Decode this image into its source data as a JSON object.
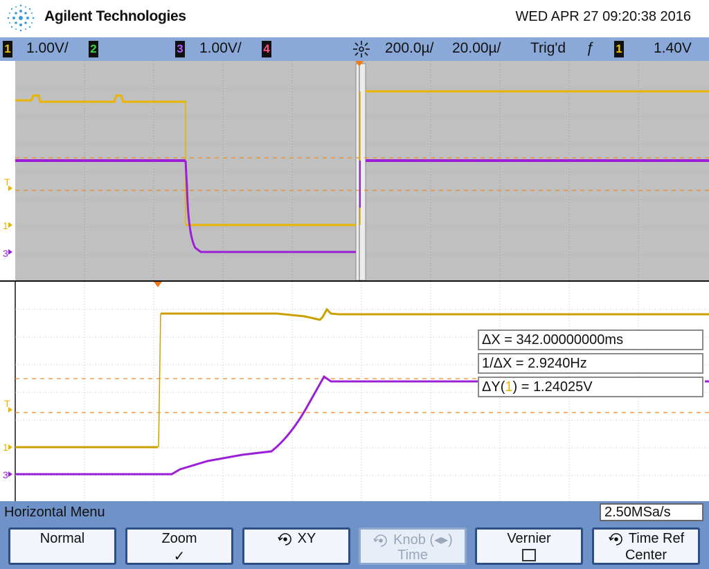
{
  "header": {
    "brand": "Agilent Technologies",
    "datetime": "WED APR 27 09:20:38 2016"
  },
  "channels": {
    "ch1_num": "1",
    "ch1_scale": "1.00V/",
    "ch2_num": "2",
    "ch3_num": "3",
    "ch3_scale": "1.00V/",
    "ch4_num": "4",
    "timebase": "200.0µ/",
    "zoom_timebase": "20.00µ/",
    "trigger_status": "Trig'd",
    "trigger_slope": "ƒ",
    "trigger_source": "1",
    "trigger_level": "1.40V"
  },
  "markers": {
    "trigger": "T",
    "ch1": "1",
    "ch3": "3"
  },
  "measurements": {
    "delta_x": "ΔX = 342.00000000ms",
    "inv_delta_x": "1/ΔX = 2.9240Hz",
    "delta_y_prefix": "ΔY(",
    "delta_y_channel": "1",
    "delta_y_suffix": ") = 1.24025V"
  },
  "menu": {
    "title": "Horizontal Menu",
    "sample_rate": "2.50MSa/s",
    "softkeys": {
      "normal": "Normal",
      "zoom": "Zoom",
      "zoom_check": "✓",
      "xy": "XY",
      "knob_time_line1": "Knob (◂▸)",
      "knob_time_line2": "Time",
      "vernier": "Vernier",
      "time_ref_line1": "Time Ref",
      "time_ref_line2": "Center"
    }
  },
  "colors": {
    "ch1": "#e8b400",
    "ch3": "#9b1fd6",
    "grid_main_bg": "#c0c0c0",
    "grid_zoom_bg": "#ffffff",
    "menu_bg": "#6f93c9",
    "trigger_marker": "#f07a1a"
  }
}
